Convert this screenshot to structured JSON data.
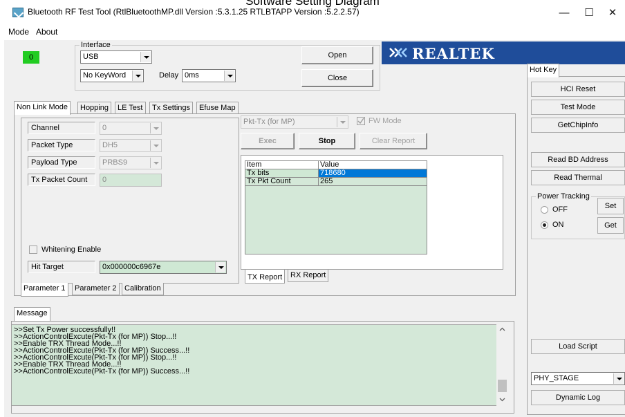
{
  "caption": "Software Setting Diagram",
  "window": {
    "title": "Bluetooth RF Test Tool (RtlBluetoothMP.dll Version :5.3.1.25   RTLBTAPP Version :5.2.2.57)",
    "minimize": "—",
    "maximize": "☐",
    "close": "✕"
  },
  "menu": {
    "mode": "Mode",
    "about": "About"
  },
  "status_indicator": "0",
  "interface": {
    "group_label": "Interface",
    "port": "USB",
    "keyword": "No KeyWord",
    "delay_label": "Delay",
    "delay": "0ms",
    "open": "Open",
    "close": "Close"
  },
  "brand": "REALTEK",
  "tabs": [
    "Non Link Mode",
    "Hopping",
    "LE Test",
    "Tx Settings",
    "Efuse Map"
  ],
  "params": {
    "channel_label": "Channel",
    "channel": "0",
    "packet_type_label": "Packet Type",
    "packet_type": "DH5",
    "payload_type_label": "Payload Type",
    "payload_type": "PRBS9",
    "tx_packet_count_label": "Tx Packet Count",
    "tx_packet_count": "0",
    "whitening_label": "Whitening Enable",
    "hit_target_label": "Hit Target",
    "hit_target": "0x000000c6967e"
  },
  "param_tabs": [
    "Parameter 1",
    "Parameter 2",
    "Calibration"
  ],
  "action": {
    "mode": "Pkt-Tx (for MP)",
    "fw_mode": "FW Mode",
    "exec": "Exec",
    "stop": "Stop",
    "clear_report": "Clear Report"
  },
  "report": {
    "headers": [
      "Item",
      "Value"
    ],
    "rows": [
      [
        "Tx bits",
        "718680"
      ],
      [
        "Tx Pkt Count",
        "265"
      ]
    ],
    "tabs": [
      "TX Report",
      "RX Report"
    ]
  },
  "message": {
    "tab": "Message",
    "lines": [
      ">>Set Tx Power successfully!!",
      ">>ActionControlExcute(Pkt-Tx (for MP)) Stop...!!",
      ">>Enable TRX Thread Mode...!!",
      ">>ActionControlExcute(Pkt-Tx (for MP)) Success...!!",
      ">>ActionControlExcute(Pkt-Tx (for MP)) Stop...!!",
      ">>Enable TRX Thread Mode...!!",
      ">>ActionControlExcute(Pkt-Tx (for MP)) Success...!!"
    ]
  },
  "hotkey": {
    "tab": "Hot Key",
    "hci_reset": "HCI Reset",
    "test_mode": "Test Mode",
    "get_chip_info": "GetChipInfo",
    "read_bd_address": "Read BD Address",
    "read_thermal": "Read Thermal",
    "power_tracking_label": "Power Tracking",
    "off": "OFF",
    "on": "ON",
    "set": "Set",
    "get": "Get",
    "load_script": "Load Script",
    "stage": "PHY_STAGE",
    "dynamic_log": "Dynamic Log"
  },
  "colors": {
    "indicator": "#22cc22",
    "brand_bg": "#1f4d9a",
    "selection": "#0078d7",
    "edit_green": "#d4e8d8"
  }
}
